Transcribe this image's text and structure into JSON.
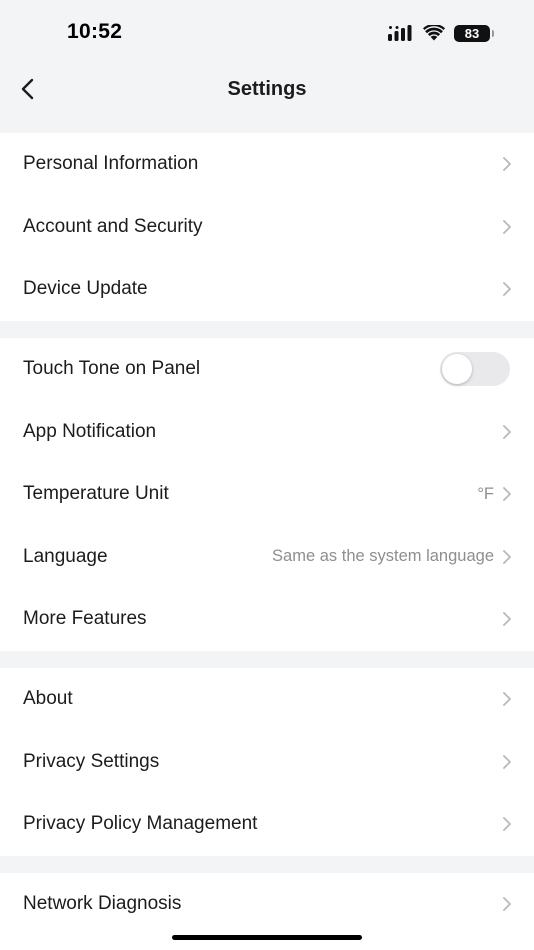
{
  "status_bar": {
    "time": "10:52",
    "battery_level": "83",
    "signal_icon": "cellular-signal-icon",
    "wifi_icon": "wifi-icon"
  },
  "header": {
    "title": "Settings",
    "back_icon": "chevron-left-icon"
  },
  "sections": [
    {
      "items": [
        {
          "label": "Personal Information",
          "type": "link"
        },
        {
          "label": "Account and Security",
          "type": "link"
        },
        {
          "label": "Device Update",
          "type": "link"
        }
      ]
    },
    {
      "items": [
        {
          "label": "Touch Tone on Panel",
          "type": "toggle",
          "toggle_on": false
        },
        {
          "label": "App Notification",
          "type": "link"
        },
        {
          "label": "Temperature Unit",
          "type": "link",
          "value": "°F"
        },
        {
          "label": "Language",
          "type": "link",
          "value": "Same as the system language"
        },
        {
          "label": "More Features",
          "type": "link"
        }
      ]
    },
    {
      "items": [
        {
          "label": "About",
          "type": "link"
        },
        {
          "label": "Privacy Settings",
          "type": "link"
        },
        {
          "label": "Privacy Policy Management",
          "type": "link"
        }
      ]
    },
    {
      "items": [
        {
          "label": "Network Diagnosis",
          "type": "link"
        }
      ]
    }
  ],
  "colors": {
    "background": "#f3f4f6",
    "card": "#ffffff",
    "text": "#1c1c1e",
    "secondary_text": "#8e8e93",
    "chevron": "#b8b8bd",
    "toggle_off": "#e9e9eb"
  }
}
